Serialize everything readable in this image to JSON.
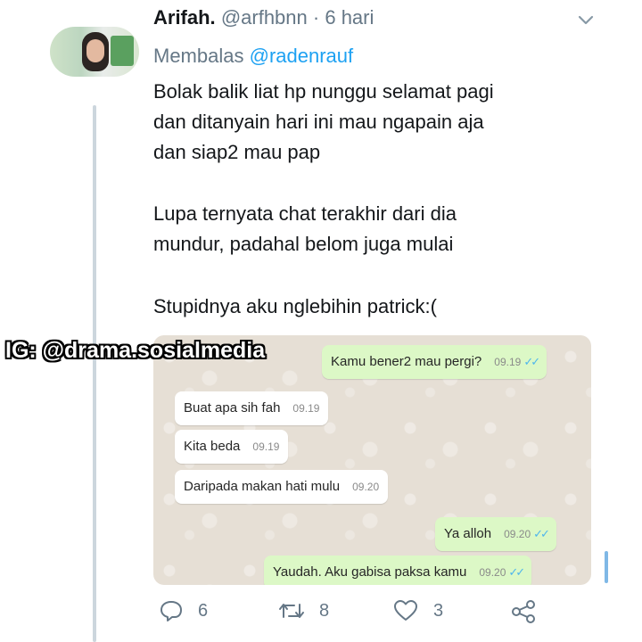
{
  "tweet": {
    "display_name": "Arifah.",
    "handle": "@arfhbnn",
    "separator": "·",
    "time": "6 hari",
    "reply_prefix": "Membalas",
    "reply_to": "@radenrauf",
    "lines": [
      "Bolak balik liat hp nunggu selamat pagi",
      "dan ditanyain hari ini mau ngapain aja",
      "dan siap2 mau pap",
      "Lupa ternyata chat terakhir dari dia",
      "mundur, padahal belom juga mulai",
      "Stupidnya aku nglebihin patrick:("
    ]
  },
  "watermark": "IG: @drama.sosialmedia",
  "chat": {
    "messages": [
      {
        "direction": "out",
        "text": "Kamu bener2 mau pergi?",
        "time": "09.19",
        "read": true
      },
      {
        "direction": "in",
        "text": "Buat apa sih fah",
        "time": "09.19"
      },
      {
        "direction": "in",
        "text": "Kita beda",
        "time": "09.19"
      },
      {
        "direction": "in",
        "text": "Daripada makan hati mulu",
        "time": "09.20"
      },
      {
        "direction": "out",
        "text": "Ya alloh",
        "time": "09.20",
        "read": true
      },
      {
        "direction": "out",
        "text": "Yaudah. Aku gabisa paksa kamu",
        "time": "09.20",
        "read": true
      }
    ],
    "read_tick": "✓✓"
  },
  "actions": {
    "replies": "6",
    "retweets": "8",
    "likes": "3"
  },
  "icons": {
    "more": "chevron-down-icon",
    "reply": "reply-icon",
    "retweet": "retweet-icon",
    "like": "heart-icon",
    "share": "share-icon"
  },
  "colors": {
    "link": "#1da1f2",
    "muted": "#657786",
    "outgoing_bubble": "#dcf8c6",
    "chat_background": "#e6dfd5",
    "read_ticks": "#4fb6ec"
  }
}
